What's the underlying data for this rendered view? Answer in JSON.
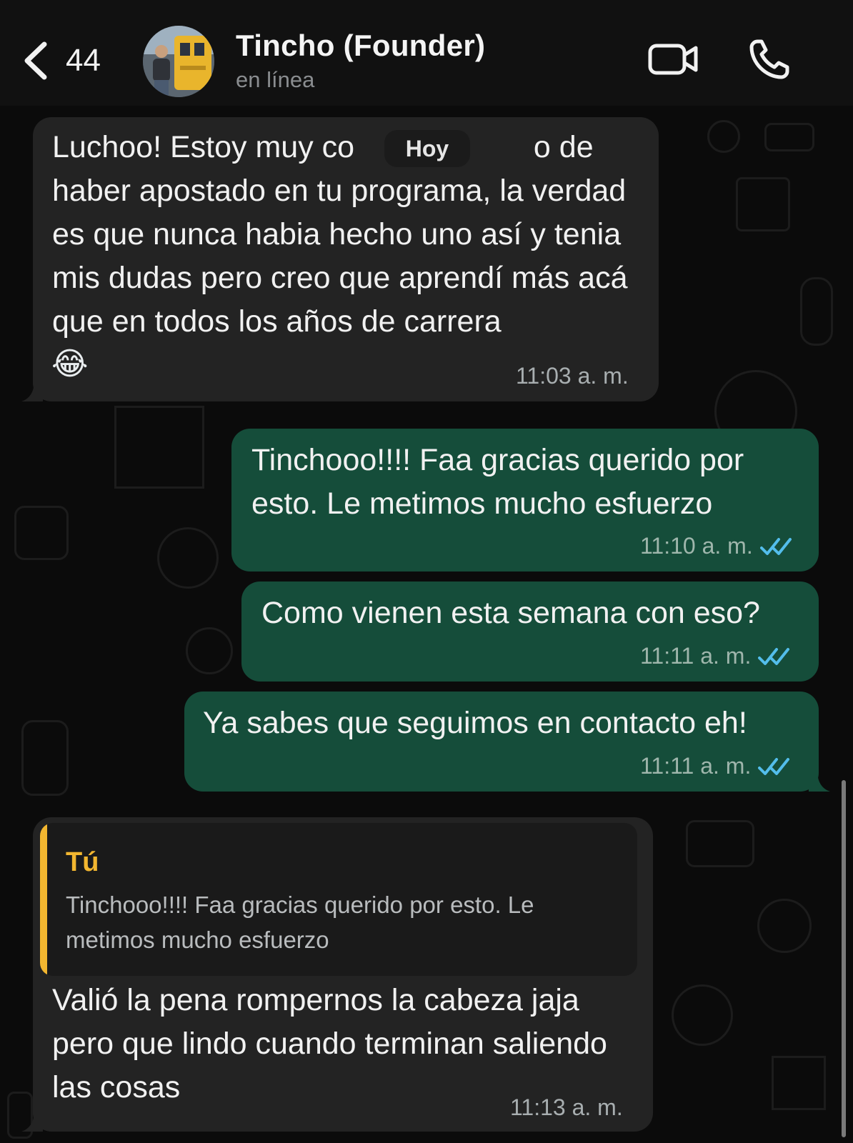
{
  "header": {
    "back_count": "44",
    "contact_name": "Tincho (Founder)",
    "status": "en línea",
    "video_icon": "video-camera-icon",
    "call_icon": "phone-icon",
    "back_icon": "chevron-left-icon"
  },
  "date_separator": "Hoy",
  "messages": [
    {
      "direction": "incoming",
      "text": "Luchoo! Estoy muy co                     o de haber apostado en tu programa, la verdad es que nunca habia hecho uno así y tenia mis dudas pero creo que aprendí más acá que en todos los años de carrera",
      "emoji": "😂",
      "time": "11:03 a. m."
    },
    {
      "direction": "outgoing",
      "text": "Tinchooo!!!! Faa gracias querido por esto. Le metimos mucho esfuerzo",
      "time": "11:10 a. m.",
      "status": "read"
    },
    {
      "direction": "outgoing",
      "text": "Como vienen esta semana con eso?",
      "time": "11:11 a. m.",
      "status": "read"
    },
    {
      "direction": "outgoing",
      "text": "Ya sabes que seguimos en contacto eh!",
      "time": "11:11 a. m.",
      "status": "read"
    },
    {
      "direction": "incoming",
      "reply_to": {
        "author": "Tú",
        "text": "Tinchooo!!!! Faa gracias querido por esto. Le metimos mucho esfuerzo"
      },
      "text": "Valió la pena rompernos la cabeza jaja pero que lindo cuando terminan saliendo las cosas",
      "time": "11:13 a. m."
    }
  ],
  "colors": {
    "incoming_bubble": "#232323",
    "outgoing_bubble": "#154d3a",
    "read_ticks": "#53bdeb",
    "quote_accent": "#f2b630"
  }
}
